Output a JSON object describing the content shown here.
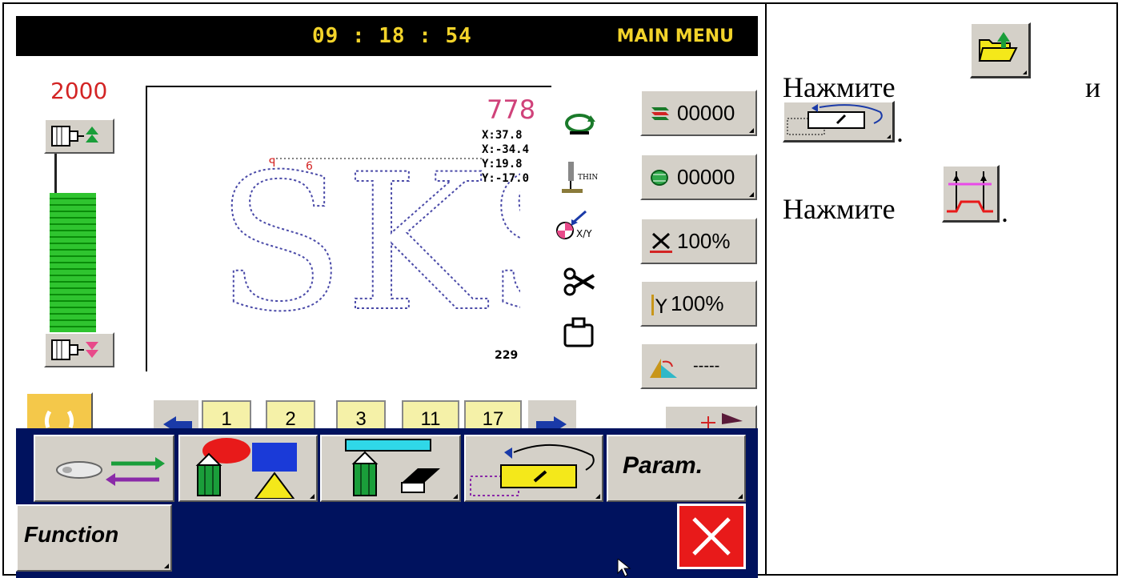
{
  "screen": {
    "clock": "09 : 18 : 54",
    "menu_title": "MAIN MENU",
    "speed_value": "2000",
    "stitch_count": "778",
    "coordinates": [
      "X:37.8",
      "X:-34.4",
      "Y:19.8",
      "Y:-17.0"
    ],
    "end_count": "229",
    "pattern_text": "SKS",
    "counter_top": "00000",
    "counter_bottom": "00000",
    "x_scale": "100%",
    "y_scale": "100%",
    "rotation_value": "-----",
    "tabs": [
      "1",
      "2",
      "3",
      "11",
      "17"
    ],
    "param_label": "Param.",
    "function_label": "Function",
    "thin_label": "THIN",
    "xy_label": "X/Y"
  },
  "instructions": {
    "line1_text": "Нажмите",
    "line1_conj": "и",
    "line2_text": "Нажмите",
    "dot": "."
  },
  "colors": {
    "clock": "#f2d32a",
    "panel_blue": "#00125e",
    "button_gray": "#d4d0c8",
    "close_red": "#e81a1a",
    "speed_red": "#d32424",
    "stitch_pink": "#d0427a",
    "slider_green": "#2fc42f",
    "tab_yellow": "#f5f1a8"
  }
}
